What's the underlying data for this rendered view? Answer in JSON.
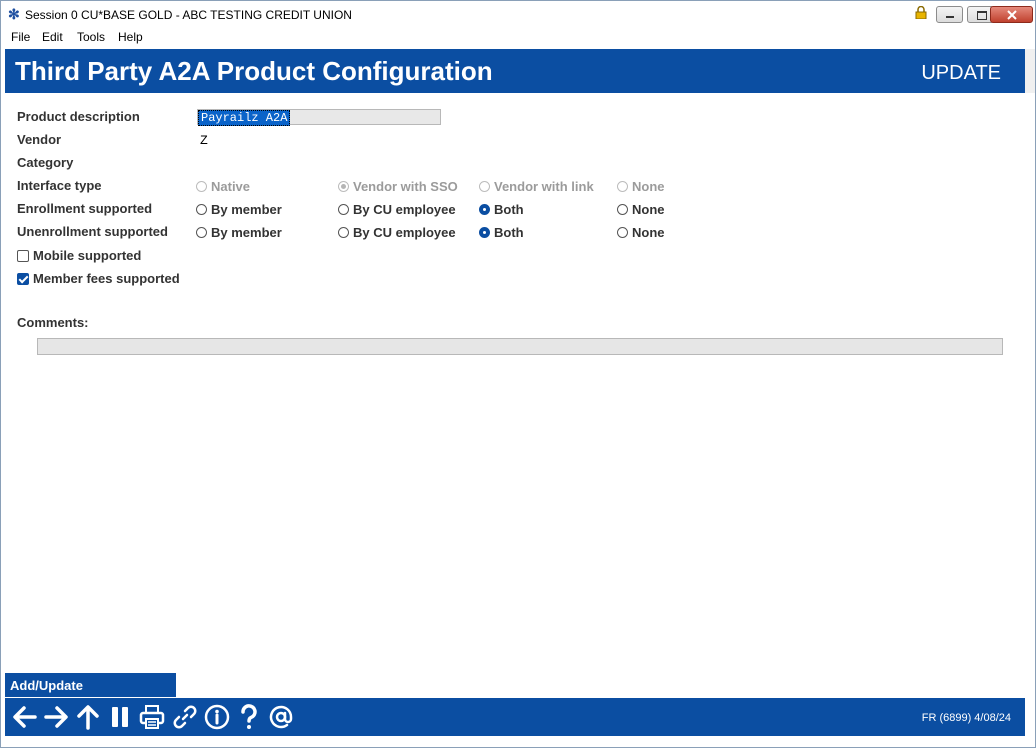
{
  "window": {
    "title": "Session 0 CU*BASE GOLD - ABC TESTING CREDIT UNION"
  },
  "menu": {
    "items": [
      "File",
      "Edit",
      "Tools",
      "Help"
    ]
  },
  "header": {
    "title": "Third Party A2A Product Configuration",
    "mode": "UPDATE"
  },
  "form": {
    "product_description_label": "Product description",
    "product_description_value": "Payrailz A2A",
    "vendor_label": "Vendor",
    "vendor_value": "Z",
    "category_label": "Category",
    "interface_type_label": "Interface type",
    "enrollment_label": "Enrollment supported",
    "unenrollment_label": "Unenrollment supported",
    "interface_options": [
      "Native",
      "Vendor with SSO",
      "Vendor with link",
      "None"
    ],
    "interface_selected": "Vendor with SSO",
    "enrollment_options": [
      "By member",
      "By CU employee",
      "Both",
      "None"
    ],
    "enrollment_selected": "Both",
    "unenrollment_options": [
      "By member",
      "By CU employee",
      "Both",
      "None"
    ],
    "unenrollment_selected": "Both",
    "mobile_label": "Mobile supported",
    "mobile_checked": false,
    "member_fees_label": "Member fees supported",
    "member_fees_checked": true,
    "comments_label": "Comments:",
    "comments_value": ""
  },
  "actions": {
    "add_update_label": "Add/Update"
  },
  "footer": {
    "icons": [
      "back-arrow-icon",
      "forward-arrow-icon",
      "up-arrow-icon",
      "pause-icon",
      "print-icon",
      "link-icon",
      "info-icon",
      "help-icon",
      "email-icon"
    ],
    "code": "FR (6899) 4/08/24"
  },
  "colors": {
    "brand_blue": "#0b4ea2",
    "selection_blue": "#0a63c9"
  }
}
